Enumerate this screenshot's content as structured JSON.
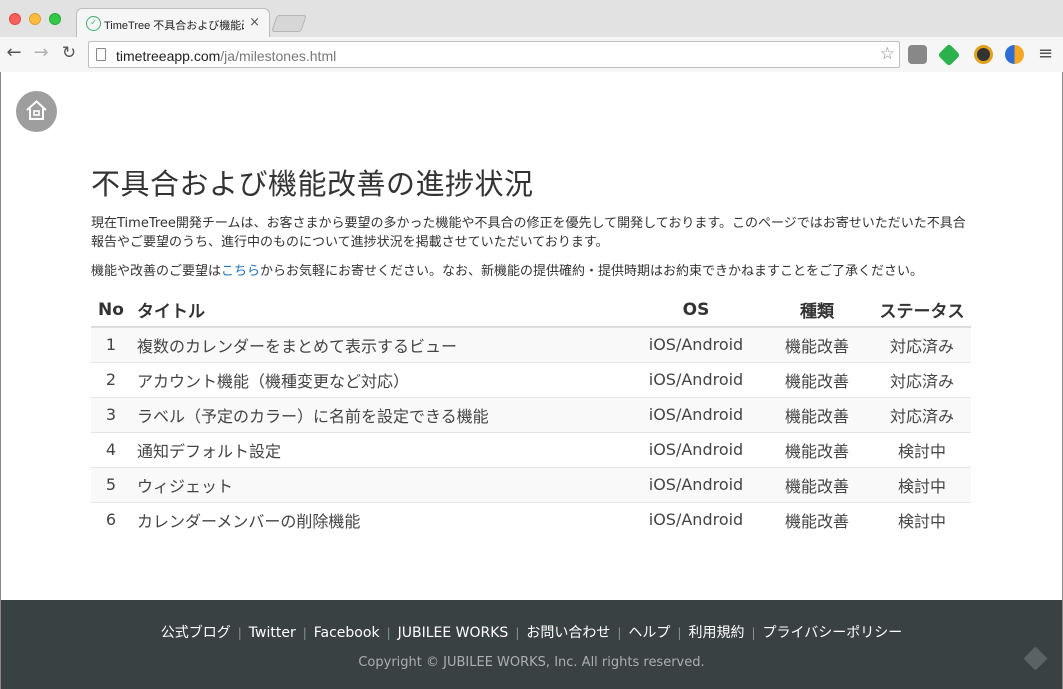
{
  "browser": {
    "tab_title": "TimeTree 不具合および機能改善の進捗状況",
    "tab_favicon": "timetree-icon",
    "url_host": "timetreeapp.com",
    "url_path": "/ja/milestones.html",
    "nav_back": "←",
    "nav_forward": "→",
    "reload": "↻",
    "star": "☆",
    "menu": "≡",
    "tab_close": "×"
  },
  "page": {
    "heading": "不具合および機能改善の進捗状況",
    "intro": "現在TimeTree開発チームは、お客さまから要望の多かった機能や不具合の修正を優先して開発しております。このページではお寄せいただいた不具合報告やご要望のうち、進行中のものについて進捗状況を掲載させていただいております。",
    "request_before": "機能や改善のご要望は",
    "request_link": "こちら",
    "request_after": "からお気軽にお寄せください。なお、新機能の提供確約・提供時期はお約束できかねますことをご了承ください。",
    "table": {
      "headers": [
        "No",
        "タイトル",
        "OS",
        "種類",
        "ステータス"
      ],
      "rows": [
        {
          "no": "1",
          "title": "複数のカレンダーをまとめて表示するビュー",
          "os": "iOS/Android",
          "kind": "機能改善",
          "status": "対応済み"
        },
        {
          "no": "2",
          "title": "アカウント機能（機種変更など対応）",
          "os": "iOS/Android",
          "kind": "機能改善",
          "status": "対応済み"
        },
        {
          "no": "3",
          "title": "ラベル（予定のカラー）に名前を設定できる機能",
          "os": "iOS/Android",
          "kind": "機能改善",
          "status": "対応済み"
        },
        {
          "no": "4",
          "title": "通知デフォルト設定",
          "os": "iOS/Android",
          "kind": "機能改善",
          "status": "検討中"
        },
        {
          "no": "5",
          "title": "ウィジェット",
          "os": "iOS/Android",
          "kind": "機能改善",
          "status": "検討中"
        },
        {
          "no": "6",
          "title": "カレンダーメンバーの削除機能",
          "os": "iOS/Android",
          "kind": "機能改善",
          "status": "検討中"
        }
      ]
    }
  },
  "footer": {
    "links": [
      "公式ブログ",
      "Twitter",
      "Facebook",
      "JUBILEE WORKS",
      "お問い合わせ",
      "ヘルプ",
      "利用規約",
      "プライバシーポリシー"
    ],
    "separator": "|",
    "copyright": "Copyright © JUBILEE WORKS, Inc. All rights reserved."
  },
  "colors": {
    "footer_bg": "#3a4143",
    "link": "#1f6fb5",
    "home_button": "#9e9e9e"
  }
}
